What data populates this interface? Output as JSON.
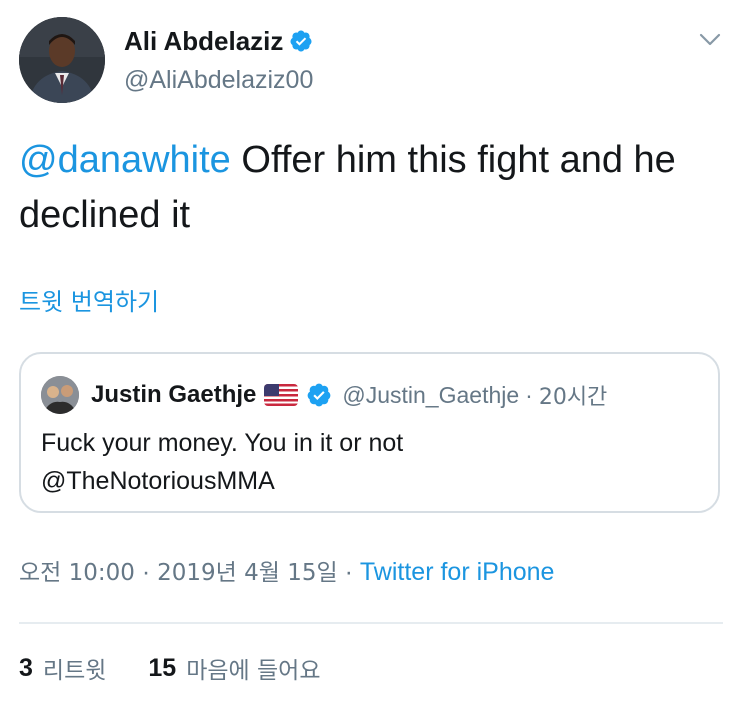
{
  "author": {
    "name": "Ali Abdelaziz",
    "handle": "@AliAbdelaziz00",
    "verified": true
  },
  "tweet": {
    "mention": "@danawhite",
    "text_rest": " Offer him this fight  and he declined it",
    "translate_label": "트윗 번역하기"
  },
  "quoted": {
    "name": "Justin Gaethje",
    "flag": "us-flag",
    "handle": "@Justin_Gaethje",
    "separator": "·",
    "time": "20시간",
    "text_line1": "Fuck your money. You in it or not",
    "text_line2": "@TheNotoriousMMA"
  },
  "meta": {
    "time": "오전 10:00",
    "separator": " · ",
    "date": "2019년 4월 15일",
    "source": "Twitter for iPhone"
  },
  "stats": {
    "retweets_count": "3",
    "retweets_label": "리트윗",
    "likes_count": "15",
    "likes_label": "마음에 들어요"
  },
  "colors": {
    "link": "#1b95e0",
    "secondary": "#657786",
    "border": "#d6dde3"
  },
  "icons": [
    "verified-badge-icon",
    "chevron-down-icon",
    "us-flag-icon"
  ]
}
